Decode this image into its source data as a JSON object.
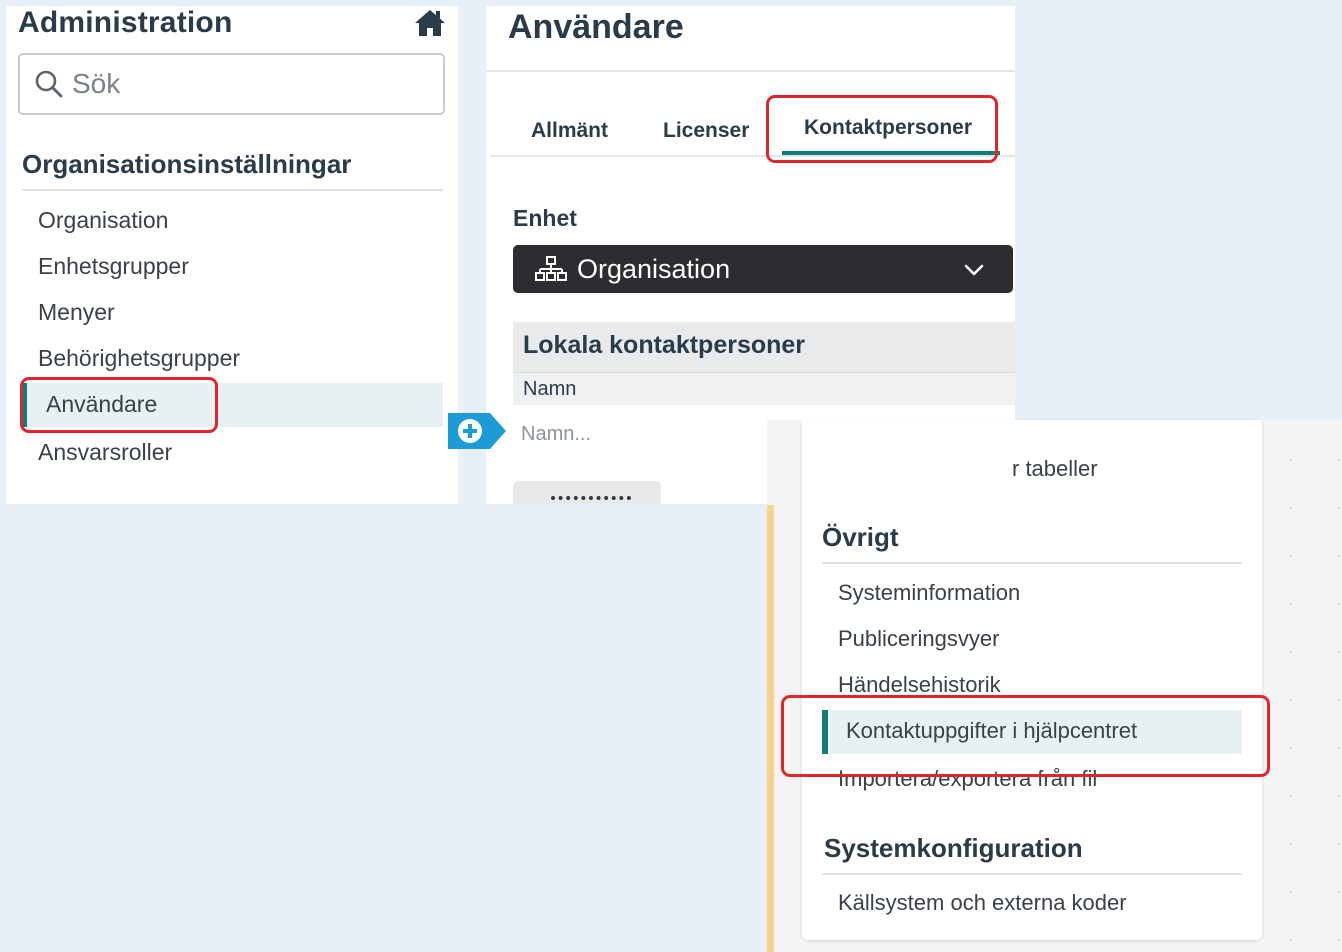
{
  "sidebar": {
    "title": "Administration",
    "search_placeholder": "Sök",
    "section_title": "Organisationsinställningar",
    "items": [
      {
        "label": "Organisation"
      },
      {
        "label": "Enhetsgrupper"
      },
      {
        "label": "Menyer"
      },
      {
        "label": "Behörighetsgrupper"
      },
      {
        "label": "Användare"
      },
      {
        "label": "Ansvarsroller"
      }
    ]
  },
  "main": {
    "page_title": "Användare",
    "tabs": [
      {
        "label": "Allmänt"
      },
      {
        "label": "Licenser"
      },
      {
        "label": "Kontaktpersoner"
      }
    ],
    "enhet_label": "Enhet",
    "enhet_value": "Organisation",
    "local_contacts_title": "Lokala kontaktpersoner",
    "column_header": "Namn",
    "name_placeholder": "Namn..."
  },
  "lower_menu": {
    "partial_item": "r tabeller",
    "section_ovrigt": "Övrigt",
    "ovrigt_items": [
      {
        "label": "Systeminformation"
      },
      {
        "label": "Publiceringsvyer"
      },
      {
        "label": "Händelsehistorik"
      },
      {
        "label": "Kontaktuppgifter i hjälpcentret"
      },
      {
        "label": "Importera/exportera från fil"
      }
    ],
    "section_sys": "Systemkonfiguration",
    "sys_items": [
      {
        "label": "Källsystem och externa koder"
      }
    ]
  },
  "colors": {
    "accent": "#127b7b",
    "highlight": "#e0262b",
    "select_bg": "#2b2d30",
    "connector": "#1d9bd6"
  }
}
